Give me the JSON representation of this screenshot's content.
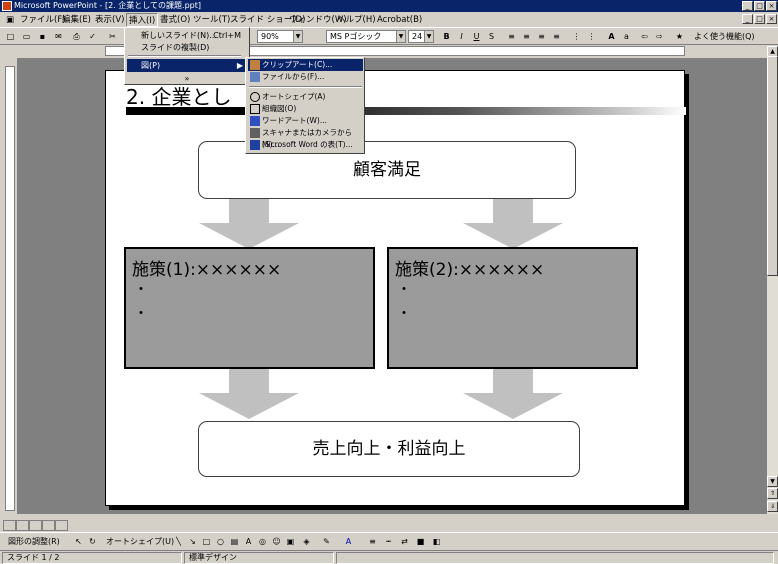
{
  "window": {
    "title": "Microsoft PowerPoint - [2. 企業としての課題.ppt]"
  },
  "menubar": {
    "items": [
      "ファイル(F)",
      "編集(E)",
      "表示(V)",
      "挿入(I)",
      "書式(O)",
      "ツール(T)",
      "スライド ショー(D)",
      "ウィンドウ(W)",
      "ヘルプ(H)",
      "Acrobat(B)"
    ]
  },
  "toolbar": {
    "zoom": "90%",
    "font": "MS Pゴシック",
    "size": "24",
    "help": "よく使う機能(Q)"
  },
  "insert_menu": {
    "new_slide": "新しいスライド(N)...",
    "new_slide_shortcut": "Ctrl+M",
    "duplicate": "スライドの複製(D)",
    "picture": "図(P)",
    "expand": "»"
  },
  "picture_submenu": {
    "items": [
      "クリップアート(C)...",
      "ファイルから(F)...",
      "オートシェイプ(A)",
      "組織図(O)",
      "ワードアート(W)...",
      "スキャナまたはカメラから(S)...",
      "Microsoft Word の表(T)..."
    ]
  },
  "slide": {
    "title": "2. 企業とし",
    "top_box": "顧客満足",
    "left_box_title": "施策(1):××××××",
    "right_box_title": "施策(2):××××××",
    "bullet": "・",
    "bottom_box": "売上向上・利益向上"
  },
  "drawbar": {
    "draw": "図形の調整(R)",
    "autoshape": "オートシェイプ(U)"
  },
  "status": {
    "slide": "スライド 1 / 2",
    "design": "標準デザイン"
  },
  "colors": {
    "titlebar": "#0a246a",
    "box_gray": "#9b9b9b",
    "arrow": "#c0c0c0"
  }
}
